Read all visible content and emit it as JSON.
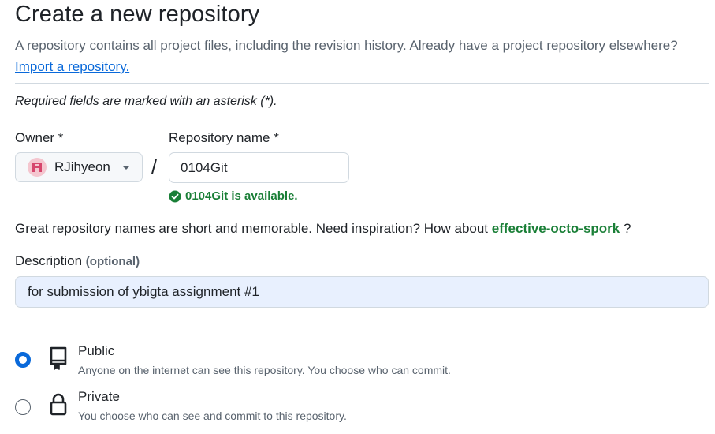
{
  "header": {
    "title": "Create a new repository",
    "subtitle": "A repository contains all project files, including the revision history. Already have a project repository elsewhere?",
    "import_link": "Import a repository."
  },
  "form": {
    "required_note": "Required fields are marked with an asterisk (*).",
    "owner": {
      "label": "Owner *",
      "selected": "RJihyeon",
      "avatar_icon": "identicon"
    },
    "separator": "/",
    "repo_name": {
      "label": "Repository name *",
      "value": "0104Git",
      "availability": "0104Git is available.",
      "availability_color": "#1a7f37"
    },
    "suggestion": {
      "prefix": "Great repository names are short and memorable. Need inspiration? How about",
      "name": "effective-octo-spork",
      "suffix": "?"
    },
    "description": {
      "label": "Description",
      "optional": "(optional)",
      "value": "for submission of ybigta assignment #1"
    },
    "visibility": [
      {
        "title": "Public",
        "description": "Anyone on the internet can see this repository. You choose who can commit.",
        "icon": "repo-icon",
        "checked": true
      },
      {
        "title": "Private",
        "description": "You choose who can see and commit to this repository.",
        "icon": "lock-icon",
        "checked": false
      }
    ]
  },
  "colors": {
    "link": "#0969da",
    "success": "#1a7f37",
    "radio_checked": "#0969da",
    "autofill_bg": "#e8f0fe"
  }
}
